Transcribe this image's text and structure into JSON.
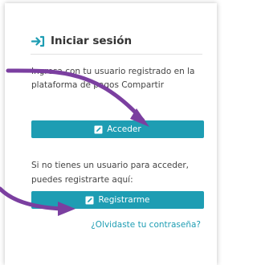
{
  "login": {
    "title": "Iniciar sesión",
    "lead": "Ingresa con tu usuario registrado en la plataforma de pagos Compartir",
    "acceder_label": "Acceder",
    "register_prompt": "Si no tienes un usuario para acceder, puedes registrarte aquí:",
    "registrarme_label": "Registrarme",
    "forgot_label": "¿Olvidaste tu contraseña?"
  },
  "colors": {
    "accent": "#1e9db3",
    "annotation_arrow": "#7b3fa0"
  },
  "icons": {
    "title": "sign-in-arrow-icon",
    "buttons": "edit-icon"
  }
}
